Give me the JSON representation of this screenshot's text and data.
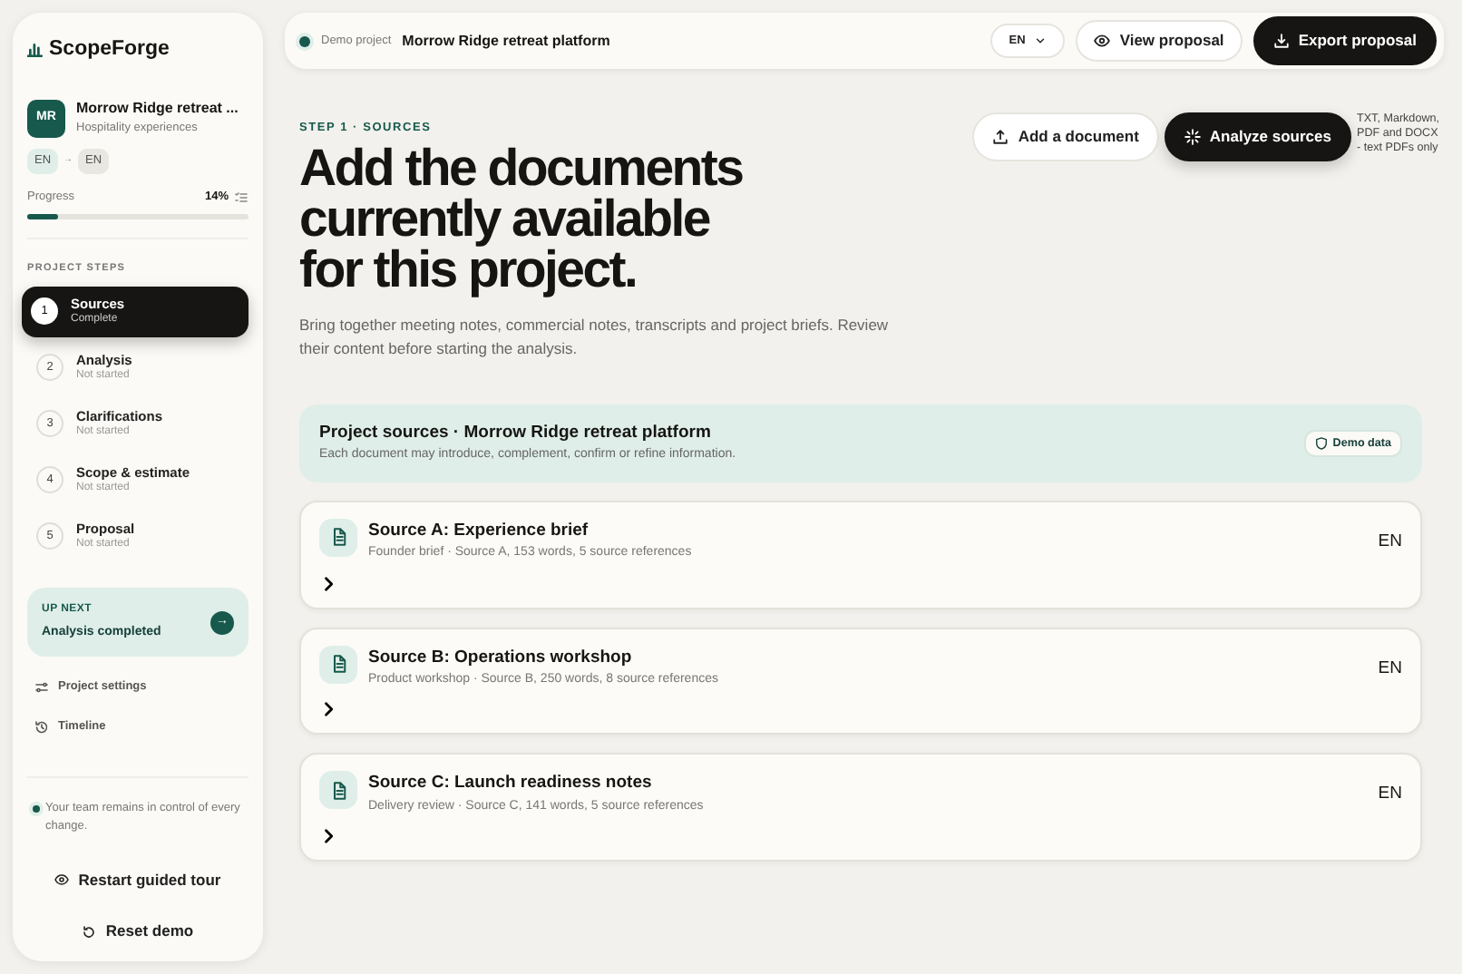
{
  "brand": {
    "name": "ScopeForge"
  },
  "project": {
    "initials": "MR",
    "name": "Morrow Ridge retreat ...",
    "category": "Hospitality experiences",
    "lang_from": "EN",
    "arrow": "→",
    "lang_to": "EN",
    "progress_label": "Progress",
    "progress_value": "14%",
    "level": 0.14
  },
  "steps_heading": "PROJECT STEPS",
  "steps": [
    {
      "number": "1",
      "title": "Sources",
      "status": "Complete",
      "selected": true
    },
    {
      "number": "2",
      "title": "Analysis",
      "status": "Not started",
      "selected": false
    },
    {
      "number": "3",
      "title": "Clarifications",
      "status": "Not started",
      "selected": false
    },
    {
      "number": "4",
      "title": "Scope & estimate",
      "status": "Not started",
      "selected": false
    },
    {
      "number": "5",
      "title": "Proposal",
      "status": "Not started",
      "selected": false
    }
  ],
  "up_next": {
    "label": "UP NEXT",
    "title": "Analysis completed",
    "arrow": "→"
  },
  "links": [
    {
      "kind": "settings",
      "label": "Project settings"
    },
    {
      "kind": "timeline",
      "label": "Timeline"
    }
  ],
  "note": "Your team remains in control of every change.",
  "sidebar_buttons": [
    {
      "kind": "tour",
      "label": "Restart guided tour"
    },
    {
      "kind": "reset",
      "label": "Reset demo"
    }
  ],
  "topbar": {
    "demo_label": "Demo project",
    "project": "Morrow Ridge retreat platform",
    "language": "EN",
    "view": "View proposal",
    "export": "Export proposal"
  },
  "page": {
    "eyebrow": "STEP 1 · SOURCES",
    "title_lines": [
      "Add the documents",
      "currently available",
      "for this project."
    ],
    "description": "Bring together meeting notes, commercial notes, transcripts and project briefs. Review their content before starting the analysis.",
    "add": "Add a document",
    "analyze": "Analyze sources",
    "formats": "TXT, Markdown, PDF and DOCX - text PDFs only"
  },
  "sources_panel": {
    "title": "Project sources · Morrow Ridge retreat platform",
    "subtitle": "Each document may introduce, complement, confirm or refine information.",
    "badge": "Demo data"
  },
  "sources": [
    {
      "title": "Source A: Experience brief",
      "meta": "Founder brief · Source A, 153 words, 5 source references",
      "language": "EN",
      "expanded": false
    },
    {
      "title": "Source B: Operations workshop",
      "meta": "Product workshop · Source B, 250 words, 8 source references",
      "language": "EN",
      "expanded": false
    },
    {
      "title": "Source C: Launch readiness notes",
      "meta": "Delivery review · Source C, 141 words, 5 source references",
      "language": "EN",
      "expanded": false
    }
  ]
}
